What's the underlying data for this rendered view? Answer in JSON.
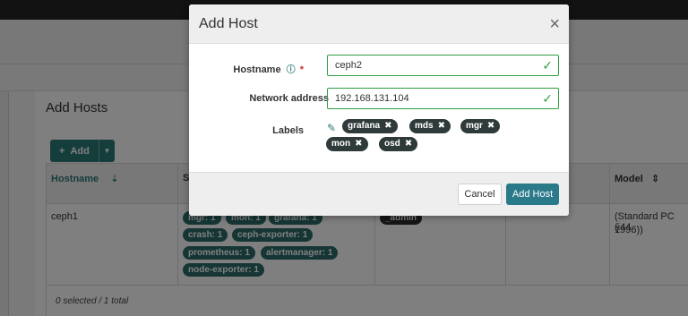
{
  "background": {
    "page_title": "Add Hosts",
    "add_button_label": "Add",
    "columns": {
      "hostname": "Hostname",
      "services_initial": "S",
      "model": "Model"
    },
    "row": {
      "hostname": "ceph1",
      "services": [
        "mgr: 1",
        "mon: 1",
        "grafana: 1",
        "crash: 1",
        "ceph-exporter: 1",
        "prometheus: 1",
        "alertmanager: 1",
        "node-exporter: 1"
      ],
      "label": "_admin",
      "model": "(Standard PC (i44",
      "model_line2": "1996))"
    },
    "footer": "0 selected / 1 total"
  },
  "modal": {
    "title": "Add Host",
    "close_symbol": "×",
    "fields": {
      "hostname_label": "Hostname",
      "hostname_value": "ceph2",
      "network_label": "Network address",
      "network_value": "192.168.131.104",
      "labels_label": "Labels"
    },
    "labels": [
      "grafana",
      "mds",
      "mgr",
      "mon",
      "osd"
    ],
    "cancel_label": "Cancel",
    "submit_label": "Add Host"
  },
  "icons": {
    "help": "help-icon",
    "check": "check-icon",
    "pencil": "pencil-icon",
    "remove": "remove-icon",
    "sort": "sort-icon"
  },
  "colors": {
    "accent": "#2b7a78",
    "valid": "#2f9e44",
    "required": "#c9302c"
  }
}
